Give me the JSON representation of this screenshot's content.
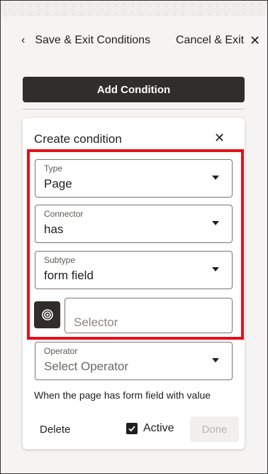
{
  "header": {
    "back_label": "Save & Exit Conditions",
    "cancel_label": "Cancel & Exit"
  },
  "add_condition_label": "Add Condition",
  "panel": {
    "title": "Create condition",
    "type": {
      "label": "Type",
      "value": "Page"
    },
    "connector": {
      "label": "Connector",
      "value": "has"
    },
    "subtype": {
      "label": "Subtype",
      "value": "form field"
    },
    "selector": {
      "placeholder": "Selector",
      "value": ""
    },
    "operator": {
      "label": "Operator",
      "placeholder": "Select Operator"
    },
    "description": "When the page has form field with value",
    "delete_label": "Delete",
    "active_label": "Active",
    "active_checked": true,
    "done_label": "Done"
  },
  "colors": {
    "primary_button": "#312d2a",
    "highlight_border": "#e3101a",
    "background": "#f5f4f2"
  }
}
